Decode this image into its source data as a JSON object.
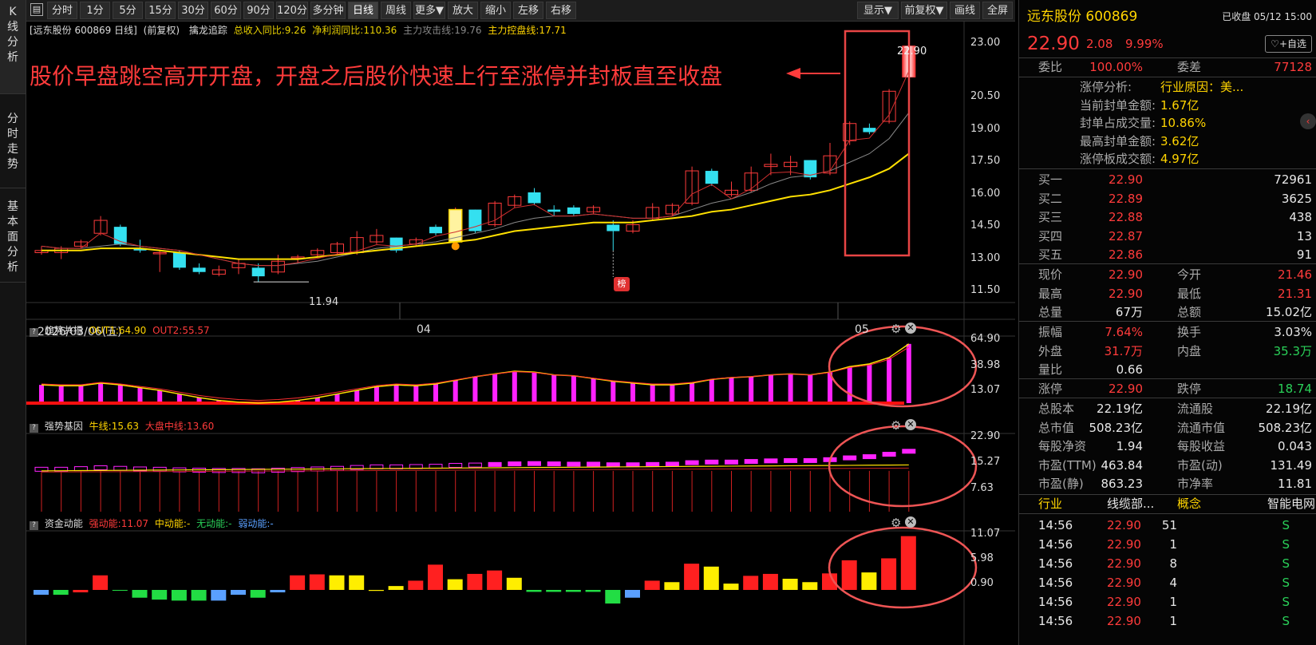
{
  "left_tabs": [
    "K线分析",
    "分时走势",
    "基本面分析"
  ],
  "toolbar": {
    "left": [
      "分时",
      "1分",
      "5分",
      "15分",
      "30分",
      "60分",
      "90分",
      "120分",
      "多分钟",
      "日线",
      "周线",
      "更多▼",
      "放大",
      "缩小",
      "左移",
      "右移"
    ],
    "selected": "日线",
    "right": [
      "显示▼",
      "前复权▼",
      "画线",
      "全屏"
    ]
  },
  "main_chart": {
    "title": "[远东股份 600869 日线]",
    "adjust": "(前复权)",
    "indicator_name": "擒龙追踪",
    "indicator_values": [
      "总收入同比:9.26",
      "净利润同比:110.36",
      "主力攻击线:19.76",
      "主力控盘线:17.71"
    ],
    "annotation": "股价早盘跳空高开开盘，开盘之后股价快速上行至涨停并封板直至收盘",
    "y_ticks": [
      "23.00",
      "20.50",
      "19.00",
      "17.50",
      "16.00",
      "14.50",
      "13.00",
      "11.50"
    ],
    "date_labels": [
      "2026/03/06(五)",
      "04",
      "05"
    ],
    "low_marker": "11.94",
    "high_marker": "22.90",
    "bang_badge": "榜"
  },
  "sub1": {
    "name": "趋势共振",
    "out1": "OUT1:64.90",
    "out2": "OUT2:55.57",
    "ticks": [
      "64.90",
      "38.98",
      "13.07"
    ]
  },
  "sub2": {
    "name": "强势基因",
    "niu": "牛线:15.63",
    "dapan": "大盘中线:13.60",
    "ticks": [
      "22.90",
      "15.27",
      "7.63"
    ]
  },
  "sub3": {
    "name": "资金动能",
    "strong": "强动能:11.07",
    "mid": "中动能:-",
    "none": "无动能:-",
    "weak": "弱动能:-",
    "ticks": [
      "11.07",
      "5.98",
      "0.90"
    ]
  },
  "quote": {
    "name": "远东股份 600869",
    "status": "已收盘 05/12 15:00",
    "price": "22.90",
    "change": "2.08",
    "pct": "9.99%",
    "fav_btn": "+自选",
    "weibi_label": "委比",
    "weibi": "100.00%",
    "weicha_label": "委差",
    "weicha": "77128",
    "limit_rows": [
      {
        "label": "涨停分析:",
        "value": "行业原因：美..."
      },
      {
        "label": "当前封单金额:",
        "value": "1.67亿"
      },
      {
        "label": "封单占成交量:",
        "value": "10.86%"
      },
      {
        "label": "最高封单金额:",
        "value": "3.62亿"
      },
      {
        "label": "涨停板成交额:",
        "value": "4.97亿"
      }
    ],
    "bids": [
      {
        "label": "买一",
        "price": "22.90",
        "vol": "72961"
      },
      {
        "label": "买二",
        "price": "22.89",
        "vol": "3625"
      },
      {
        "label": "买三",
        "price": "22.88",
        "vol": "438"
      },
      {
        "label": "买四",
        "price": "22.87",
        "vol": "13"
      },
      {
        "label": "买五",
        "price": "22.86",
        "vol": "91"
      }
    ],
    "stats1": [
      {
        "l1": "现价",
        "v1": "22.90",
        "c1": "red",
        "l2": "今开",
        "v2": "21.46",
        "c2": "red"
      },
      {
        "l1": "最高",
        "v1": "22.90",
        "c1": "red",
        "l2": "最低",
        "v2": "21.31",
        "c2": "red"
      },
      {
        "l1": "总量",
        "v1": "67万",
        "c1": "white",
        "l2": "总额",
        "v2": "15.02亿",
        "c2": "white"
      }
    ],
    "stats2": [
      {
        "l1": "振幅",
        "v1": "7.64%",
        "c1": "red",
        "l2": "换手",
        "v2": "3.03%",
        "c2": "white"
      },
      {
        "l1": "外盘",
        "v1": "31.7万",
        "c1": "red",
        "l2": "内盘",
        "v2": "35.3万",
        "c2": "green"
      },
      {
        "l1": "量比",
        "v1": "0.66",
        "c1": "white",
        "l2": "",
        "v2": "",
        "c2": "white"
      }
    ],
    "stats3": [
      {
        "l1": "涨停",
        "v1": "22.90",
        "c1": "red",
        "l2": "跌停",
        "v2": "18.74",
        "c2": "green"
      }
    ],
    "stats4": [
      {
        "l1": "总股本",
        "v1": "22.19亿",
        "c1": "white",
        "l2": "流通股",
        "v2": "22.19亿",
        "c2": "white"
      },
      {
        "l1": "总市值",
        "v1": "508.23亿",
        "c1": "white",
        "l2": "流通市值",
        "v2": "508.23亿",
        "c2": "white"
      },
      {
        "l1": "每股净资",
        "v1": "1.94",
        "c1": "white",
        "l2": "每股收益",
        "v2": "0.043",
        "c2": "white"
      },
      {
        "l1": "市盈(TTM)",
        "v1": "463.84",
        "c1": "white",
        "l2": "市盈(动)",
        "v2": "131.49",
        "c2": "white"
      },
      {
        "l1": "市盈(静)",
        "v1": "863.23",
        "c1": "white",
        "l2": "市净率",
        "v2": "11.81",
        "c2": "white"
      }
    ],
    "industry": {
      "l1": "行业",
      "v1": "线缆部...",
      "l2": "概念",
      "v2": "智能电网"
    },
    "ticks": [
      {
        "time": "14:56",
        "price": "22.90",
        "vol": "51",
        "dir": "S"
      },
      {
        "time": "14:56",
        "price": "22.90",
        "vol": "1",
        "dir": "S"
      },
      {
        "time": "14:56",
        "price": "22.90",
        "vol": "8",
        "dir": "S"
      },
      {
        "time": "14:56",
        "price": "22.90",
        "vol": "4",
        "dir": "S"
      },
      {
        "time": "14:56",
        "price": "22.90",
        "vol": "1",
        "dir": "S"
      },
      {
        "time": "14:56",
        "price": "22.90",
        "vol": "1",
        "dir": "S"
      }
    ]
  },
  "chart_data": {
    "type": "candlestick",
    "y_range": [
      11.5,
      23.0
    ],
    "candles": [
      {
        "o": 13.3,
        "c": 13.4,
        "h": 13.6,
        "l": 13.2
      },
      {
        "o": 13.3,
        "c": 13.5,
        "h": 13.6,
        "l": 13.0
      },
      {
        "o": 13.6,
        "c": 13.8,
        "h": 13.9,
        "l": 13.5
      },
      {
        "o": 14.2,
        "c": 14.8,
        "h": 15.0,
        "l": 14.1
      },
      {
        "o": 14.5,
        "c": 13.7,
        "h": 14.6,
        "l": 13.6
      },
      {
        "o": 13.5,
        "c": 13.4,
        "h": 13.9,
        "l": 13.3
      },
      {
        "o": 13.3,
        "c": 13.3,
        "h": 13.4,
        "l": 12.4
      },
      {
        "o": 13.3,
        "c": 12.6,
        "h": 13.4,
        "l": 12.5
      },
      {
        "o": 12.6,
        "c": 12.4,
        "h": 12.8,
        "l": 12.3
      },
      {
        "o": 12.3,
        "c": 12.5,
        "h": 12.7,
        "l": 12.2
      },
      {
        "o": 12.6,
        "c": 12.8,
        "h": 13.0,
        "l": 12.3
      },
      {
        "o": 12.6,
        "c": 12.2,
        "h": 12.8,
        "l": 11.94
      },
      {
        "o": 12.4,
        "c": 12.9,
        "h": 13.2,
        "l": 12.3
      },
      {
        "o": 13.1,
        "c": 13.1,
        "h": 13.2,
        "l": 12.8
      },
      {
        "o": 13.2,
        "c": 13.4,
        "h": 13.5,
        "l": 13.1
      },
      {
        "o": 13.3,
        "c": 13.7,
        "h": 13.8,
        "l": 13.2
      },
      {
        "o": 13.3,
        "c": 14.0,
        "h": 14.3,
        "l": 13.2
      },
      {
        "o": 13.8,
        "c": 14.1,
        "h": 14.4,
        "l": 13.7
      },
      {
        "o": 14.0,
        "c": 13.4,
        "h": 14.0,
        "l": 13.3
      },
      {
        "o": 13.7,
        "c": 13.9,
        "h": 14.0,
        "l": 13.6
      },
      {
        "o": 14.5,
        "c": 14.2,
        "h": 14.6,
        "l": 14.1
      },
      {
        "o": 13.8,
        "c": 15.3,
        "h": 15.4,
        "l": 13.7
      },
      {
        "o": 15.3,
        "c": 14.3,
        "h": 15.3,
        "l": 14.2
      },
      {
        "o": 14.6,
        "c": 15.6,
        "h": 15.7,
        "l": 14.5
      },
      {
        "o": 15.5,
        "c": 15.9,
        "h": 16.0,
        "l": 15.4
      },
      {
        "o": 16.1,
        "c": 15.6,
        "h": 16.3,
        "l": 15.5
      },
      {
        "o": 15.3,
        "c": 15.2,
        "h": 15.5,
        "l": 15.0
      },
      {
        "o": 15.4,
        "c": 15.1,
        "h": 15.5,
        "l": 15.0
      },
      {
        "o": 15.2,
        "c": 15.4,
        "h": 15.5,
        "l": 15.1
      },
      {
        "o": 14.6,
        "c": 14.3,
        "h": 14.8,
        "l": 13.4
      },
      {
        "o": 14.3,
        "c": 14.6,
        "h": 14.8,
        "l": 14.2
      },
      {
        "o": 14.9,
        "c": 15.4,
        "h": 15.6,
        "l": 14.8
      },
      {
        "o": 15.1,
        "c": 15.5,
        "h": 15.6,
        "l": 15.0
      },
      {
        "o": 15.6,
        "c": 17.1,
        "h": 17.3,
        "l": 15.5
      },
      {
        "o": 17.1,
        "c": 16.5,
        "h": 17.2,
        "l": 16.4
      },
      {
        "o": 16.0,
        "c": 16.2,
        "h": 16.6,
        "l": 15.9
      },
      {
        "o": 16.2,
        "c": 17.0,
        "h": 17.3,
        "l": 16.1
      },
      {
        "o": 17.3,
        "c": 17.4,
        "h": 17.9,
        "l": 16.9
      },
      {
        "o": 17.3,
        "c": 17.5,
        "h": 17.8,
        "l": 16.9
      },
      {
        "o": 17.6,
        "c": 16.8,
        "h": 17.6,
        "l": 16.7
      },
      {
        "o": 17.0,
        "c": 17.8,
        "h": 18.4,
        "l": 16.9
      },
      {
        "o": 18.5,
        "c": 19.3,
        "h": 19.4,
        "l": 18.3
      },
      {
        "o": 19.1,
        "c": 18.9,
        "h": 19.3,
        "l": 18.8
      },
      {
        "o": 19.4,
        "c": 20.8,
        "h": 20.9,
        "l": 19.3
      },
      {
        "o": 21.46,
        "c": 22.9,
        "h": 22.9,
        "l": 21.31
      }
    ],
    "ma_gray": [
      13.6,
      13.5,
      13.5,
      13.6,
      13.7,
      13.6,
      13.5,
      13.4,
      13.2,
      13.0,
      12.8,
      12.7,
      12.7,
      12.8,
      12.9,
      13.1,
      13.3,
      13.5,
      13.6,
      13.7,
      13.8,
      14.0,
      14.2,
      14.4,
      14.7,
      14.9,
      15.0,
      15.0,
      15.1,
      15.0,
      14.9,
      14.9,
      15.0,
      15.3,
      15.6,
      15.8,
      16.1,
      16.5,
      16.8,
      16.9,
      17.1,
      17.5,
      17.9,
      18.6,
      19.8
    ],
    "ma_yellow": [
      13.4,
      13.4,
      13.4,
      13.5,
      13.5,
      13.5,
      13.4,
      13.3,
      13.2,
      13.1,
      13.0,
      13.0,
      13.0,
      13.0,
      13.1,
      13.2,
      13.3,
      13.4,
      13.5,
      13.6,
      13.7,
      13.8,
      13.9,
      14.1,
      14.3,
      14.4,
      14.5,
      14.6,
      14.7,
      14.7,
      14.7,
      14.8,
      14.9,
      15.0,
      15.2,
      15.3,
      15.5,
      15.7,
      15.9,
      16.0,
      16.2,
      16.5,
      16.8,
      17.2,
      17.9
    ]
  }
}
